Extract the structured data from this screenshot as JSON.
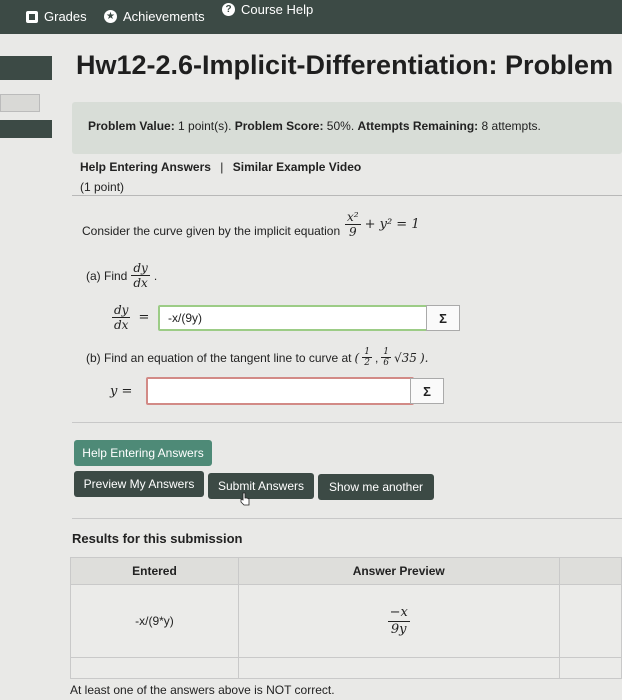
{
  "nav": {
    "grades": "Grades",
    "achievements": "Achievements",
    "course_help": "Course Help"
  },
  "title": "Hw12-2.6-Implicit-Differentiation: Problem",
  "problem_info": {
    "value_label": "Problem Value:",
    "value": "1 point(s).",
    "score_label": "Problem Score:",
    "score": "50%.",
    "attempts_label": "Attempts Remaining:",
    "attempts": "8 attempts."
  },
  "help_links": {
    "help": "Help Entering Answers",
    "separator": "|",
    "video": "Similar Example Video"
  },
  "points": "(1 point)",
  "question": {
    "prompt": "Consider the curve given by the implicit equation",
    "eq_num": "x²",
    "eq_den": "9",
    "eq_rest": "+ y² = 1",
    "part_a_prefix": "(a) Find",
    "dy": "dy",
    "dx": "dx",
    "period": ".",
    "equals": "=",
    "part_b_text": "(b) Find an equation of the tangent line to curve at",
    "point_open": "(",
    "half_num": "1",
    "half_den": "2",
    "comma": ",",
    "sixth_num": "1",
    "sixth_den": "6",
    "sqrt": "√35",
    "point_close": ").",
    "y_label": "y ="
  },
  "answers": {
    "a_value": "-x/(9y)",
    "b_value": ""
  },
  "sigma": "Σ",
  "buttons": {
    "help": "Help Entering Answers",
    "preview": "Preview My Answers",
    "submit": "Submit Answers",
    "another": "Show me another"
  },
  "results": {
    "title": "Results for this submission",
    "col_entered": "Entered",
    "col_preview": "Answer Preview",
    "entered_1": "-x/(9*y)",
    "preview_num": "−x",
    "preview_den": "9y",
    "status_colors": {
      "correct": "#68d355",
      "incorrect": "#e49c98"
    }
  },
  "footer_note": "At least one of the answers above is NOT correct."
}
